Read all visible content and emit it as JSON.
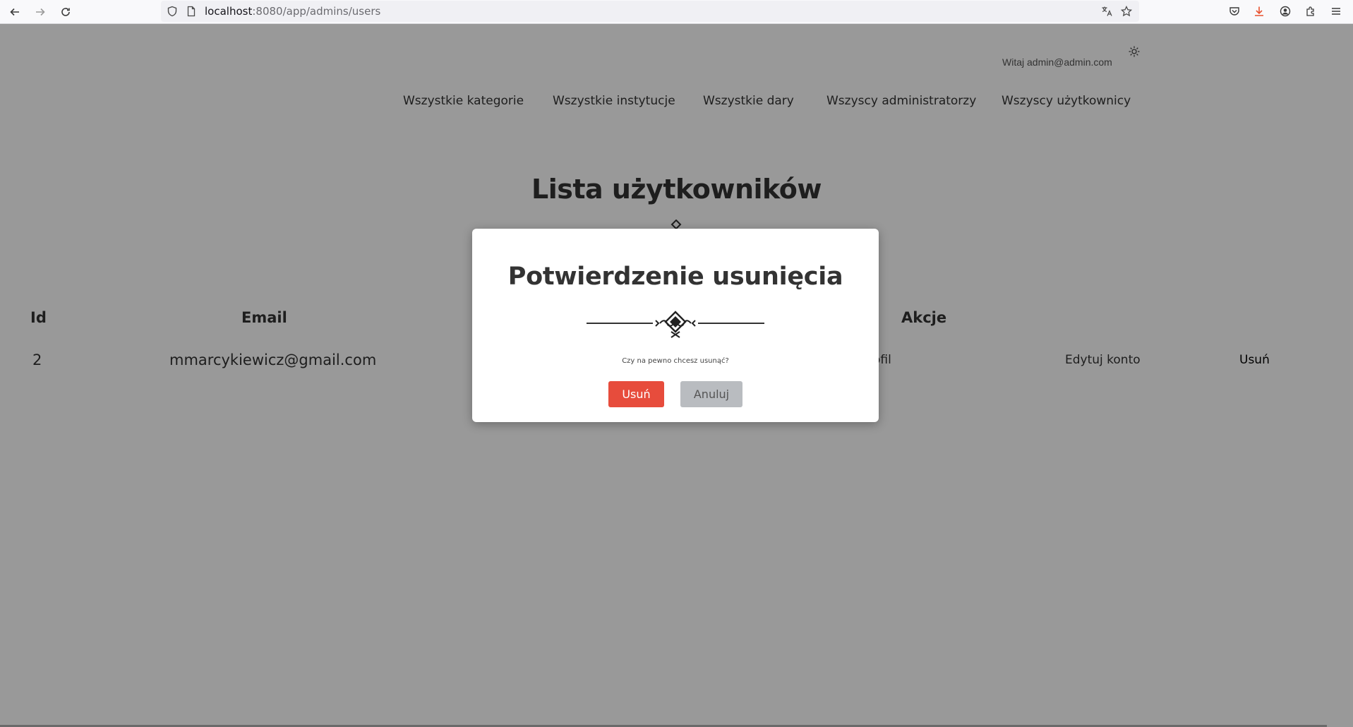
{
  "browser": {
    "url_host": "localhost",
    "url_path": ":8080/app/admins/users"
  },
  "header": {
    "greeting": "Witaj admin@admin.com"
  },
  "nav": {
    "items": [
      {
        "label": "Wszystkie kategorie"
      },
      {
        "label": "Wszystkie instytucje"
      },
      {
        "label": "Wszystkie dary"
      },
      {
        "label": "Wszyscy administratorzy"
      },
      {
        "label": "Wszyscy użytkownicy"
      }
    ]
  },
  "page": {
    "title": "Lista użytkowników"
  },
  "table": {
    "headers": {
      "id": "Id",
      "email": "Email",
      "actions": "Akcje"
    },
    "rows": [
      {
        "id": "2",
        "email": "mmarcykiewicz@gmail.com",
        "profile_partial": "ofil",
        "edit": "Edytuj konto",
        "delete": "Usuń"
      }
    ]
  },
  "modal": {
    "title": "Potwierdzenie usunięcia",
    "question": "Czy na pewno chcesz usunąć?",
    "confirm_label": "Usuń",
    "cancel_label": "Anuluj"
  },
  "colors": {
    "danger": "#e74c3c",
    "secondary": "#b9bcc0",
    "overlay": "rgba(0,0,0,0.4)"
  }
}
